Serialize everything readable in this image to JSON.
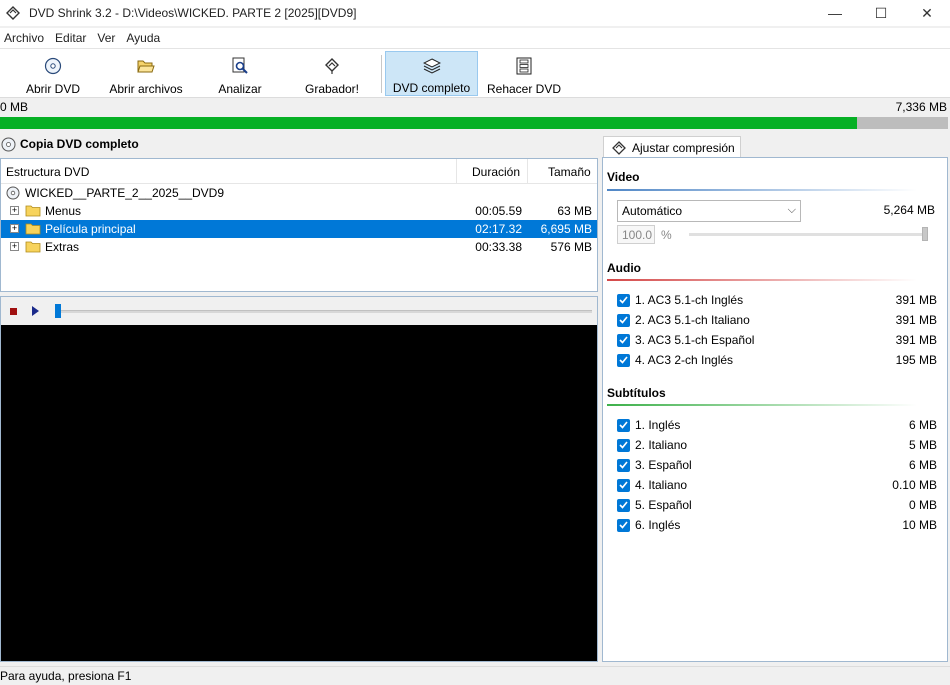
{
  "window": {
    "title": "DVD Shrink 3.2 - D:\\Videos\\WICKED. PARTE 2 [2025][DVD9]",
    "minimize_glyph": "—",
    "maximize_glyph": "☐",
    "close_glyph": "✕"
  },
  "menu": [
    "Archivo",
    "Editar",
    "Ver",
    "Ayuda"
  ],
  "toolbar": {
    "open_dvd": "Abrir DVD",
    "open_files": "Abrir archivos",
    "analyze": "Analizar",
    "burner": "Grabador!",
    "full_dvd": "DVD completo",
    "reauthor": "Rehacer DVD"
  },
  "size_bar": {
    "left": "0 MB",
    "right": "7,336 MB",
    "fill_fraction": 0.904
  },
  "left_panel": {
    "title": "Copia DVD completo",
    "columns": {
      "structure": "Estructura DVD",
      "duration": "Duración",
      "size": "Tamaño"
    },
    "root": "WICKED__PARTE_2__2025__DVD9",
    "items": [
      {
        "name": "Menus",
        "duration": "00:05.59",
        "size": "63 MB",
        "selected": false
      },
      {
        "name": "Película principal",
        "duration": "02:17.32",
        "size": "6,695 MB",
        "selected": true
      },
      {
        "name": "Extras",
        "duration": "00:33.38",
        "size": "576 MB",
        "selected": false
      }
    ]
  },
  "right_panel": {
    "tab": "Ajustar compresión",
    "video": {
      "title": "Video",
      "mode": "Automático",
      "size": "5,264 MB",
      "percent": "100.0",
      "percent_sign": "%"
    },
    "audio": {
      "title": "Audio",
      "tracks": [
        {
          "label": "1. AC3 5.1-ch Inglés",
          "size": "391 MB",
          "checked": true
        },
        {
          "label": "2. AC3 5.1-ch Italiano",
          "size": "391 MB",
          "checked": true
        },
        {
          "label": "3. AC3 5.1-ch Español",
          "size": "391 MB",
          "checked": true
        },
        {
          "label": "4. AC3 2-ch Inglés",
          "size": "195 MB",
          "checked": true
        }
      ]
    },
    "subtitles": {
      "title": "Subtítulos",
      "tracks": [
        {
          "label": "1. Inglés",
          "size": "6 MB",
          "checked": true
        },
        {
          "label": "2. Italiano",
          "size": "5 MB",
          "checked": true
        },
        {
          "label": "3. Español",
          "size": "6 MB",
          "checked": true
        },
        {
          "label": "4. Italiano",
          "size": "0.10 MB",
          "checked": true
        },
        {
          "label": "5. Español",
          "size": "0 MB",
          "checked": true
        },
        {
          "label": "6. Inglés",
          "size": "10 MB",
          "checked": true
        }
      ]
    }
  },
  "status": "Para ayuda, presiona F1",
  "colors": {
    "accent": "#0078d7",
    "progress": "#06b025",
    "stop": "#a01010"
  }
}
